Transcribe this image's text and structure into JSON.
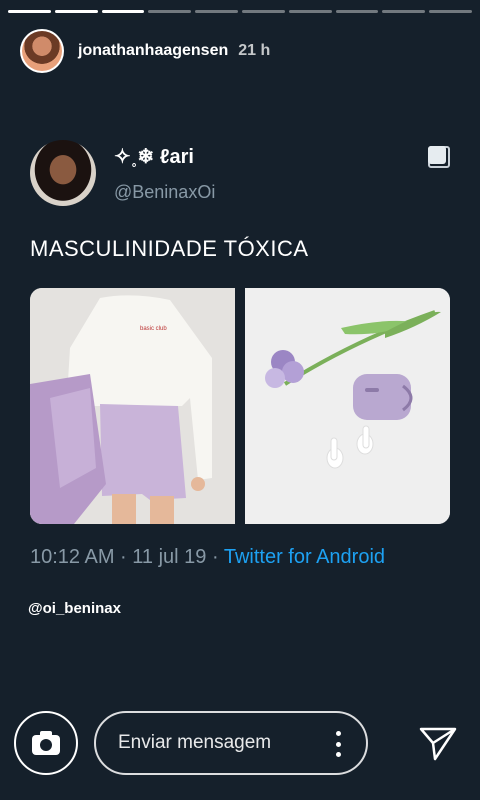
{
  "story": {
    "progress_segments": 10,
    "segments_done": 3,
    "username": "jonathanhaagensen",
    "time_ago": "21 h"
  },
  "tweet": {
    "display_name": "✧˳❄ ℓari",
    "handle": "@BeninaxOi",
    "text": "MASCULINIDADE TÓXICA",
    "timestamp": "10:12 AM · 11 jul 19 · ",
    "source": "Twitter for Android",
    "images": [
      "lilac-outfit-photo",
      "airpods-and-flower-photo"
    ],
    "shirt_text": "basic club"
  },
  "mention": "@oi_beninax",
  "reply": {
    "placeholder": "Enviar mensagem"
  },
  "colors": {
    "background": "#15202b",
    "link": "#1da1f2",
    "muted": "#8899a6"
  },
  "icons": [
    "camera-icon",
    "more-vertical-icon",
    "send-icon",
    "copy-icon"
  ]
}
